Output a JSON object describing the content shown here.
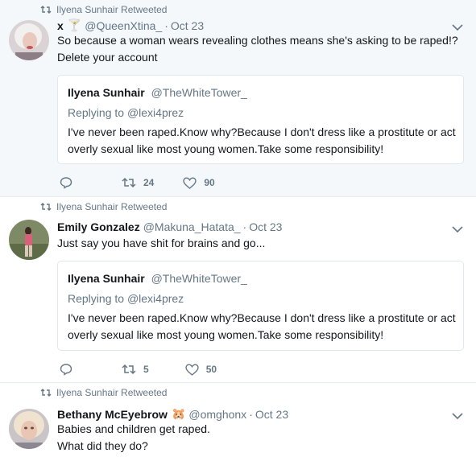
{
  "tweets": [
    {
      "retweeted_by": "Ilyena Sunhair Retweeted",
      "name": "x",
      "emoji": "🍸",
      "handle": "@QueenXtina_",
      "time": "Oct 23",
      "text": "So because a woman wears revealing clothes means she's asking to be raped!? Delete your account",
      "quote": {
        "name": "Ilyena Sunhair",
        "handle": "@TheWhiteTower_",
        "replying_prefix": "Replying to",
        "replying_to": "@lexi4prez",
        "text": "I've never been raped.Know why?Because I don't dress like a prostitute or act overly sexual like most young women.Take some responsibility!"
      },
      "retweets": "24",
      "likes": "90"
    },
    {
      "retweeted_by": "Ilyena Sunhair Retweeted",
      "name": "Emily Gonzalez",
      "handle": "@Makuna_Hatata_",
      "time": "Oct 23",
      "text": "Just say you have shit for brains and go...",
      "quote": {
        "name": "Ilyena Sunhair",
        "handle": "@TheWhiteTower_",
        "replying_prefix": "Replying to",
        "replying_to": "@lexi4prez",
        "text": "I've never been raped.Know why?Because I don't dress like a prostitute or act overly sexual like most young women.Take some responsibility!"
      },
      "retweets": "5",
      "likes": "50"
    },
    {
      "retweeted_by": "Ilyena Sunhair Retweeted",
      "name": "Bethany McEyebrow",
      "emoji": "🐹",
      "handle": "@omghonx",
      "time": "Oct 23",
      "text_line1": "Babies and children get raped.",
      "text_line2": "What did they do?"
    }
  ],
  "separator": "·",
  "icons": [
    "retweet-icon",
    "reply-icon",
    "like-icon",
    "chevron-down-icon"
  ],
  "colors": {
    "muted": "#657786",
    "text": "#14171a",
    "border": "#e1e8ed",
    "highlight_bg": "#f5f8fa"
  }
}
